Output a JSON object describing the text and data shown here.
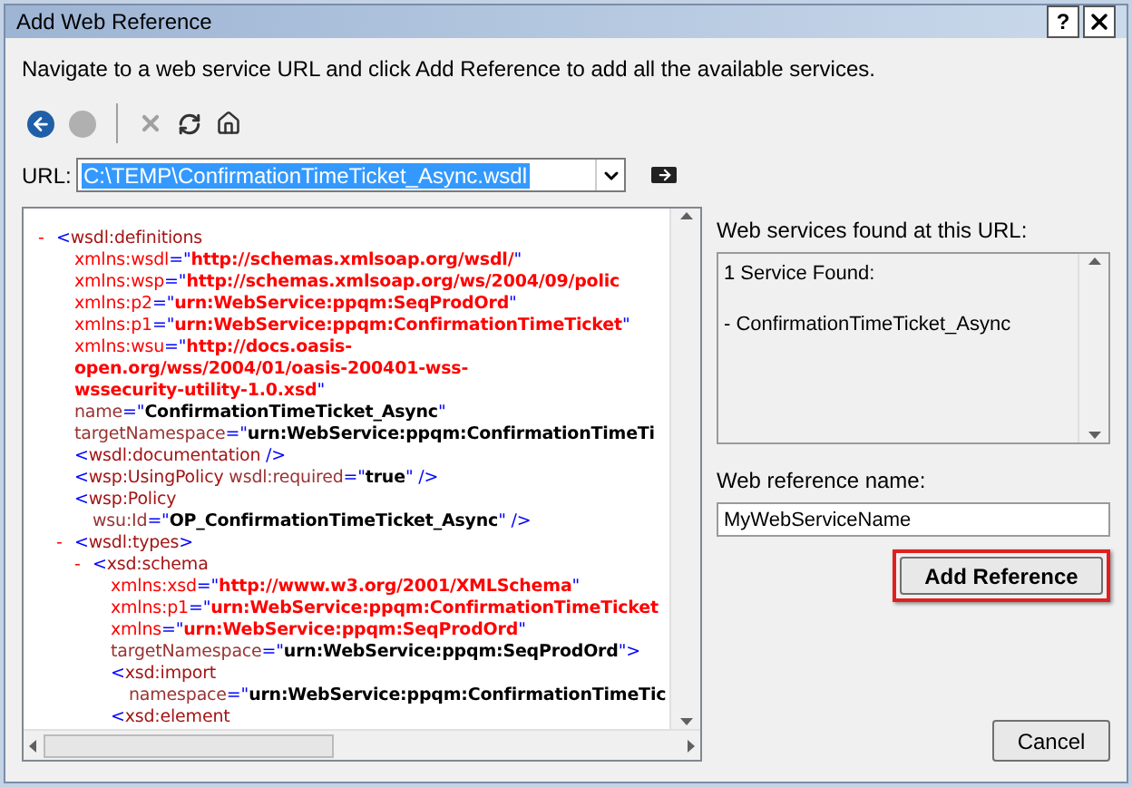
{
  "window": {
    "title": "Add Web Reference",
    "help": "?"
  },
  "instruction": "Navigate to a web service URL and click Add Reference to add all the available services.",
  "toolbar": [
    {
      "kind": "back",
      "disabled": false
    },
    {
      "kind": "stop",
      "disabled": true
    },
    {
      "kind": "separator"
    },
    {
      "kind": "delete",
      "disabled": true
    },
    {
      "kind": "refresh",
      "disabled": false
    },
    {
      "kind": "home",
      "disabled": false
    }
  ],
  "url": {
    "label": "URL:",
    "value": "C:\\TEMP\\ConfirmationTimeTicket_Async.wsdl",
    "text_selected": true
  },
  "xml": [
    {
      "toggle": "-",
      "lines": [
        [
          {
            "kind": "punct",
            "text": "<"
          },
          {
            "kind": "element",
            "text": "wsdl:definitions"
          }
        ],
        [
          {
            "kind": "ns_attr",
            "text": "xmlns:wsdl"
          },
          {
            "kind": "punct",
            "text": "=\""
          },
          {
            "kind": "ns_value",
            "text": "http://schemas.xmlsoap.org/wsdl/"
          },
          {
            "kind": "punct",
            "text": "\""
          }
        ],
        [
          {
            "kind": "ns_attr",
            "text": "xmlns:wsp"
          },
          {
            "kind": "punct",
            "text": "=\""
          },
          {
            "kind": "ns_value",
            "text": "http://schemas.xmlsoap.org/ws/2004/09/polic"
          }
        ],
        [
          {
            "kind": "ns_attr",
            "text": "xmlns:p2"
          },
          {
            "kind": "punct",
            "text": "=\""
          },
          {
            "kind": "ns_value",
            "text": "urn:WebService:ppqm:SeqProdOrd"
          },
          {
            "kind": "punct",
            "text": "\""
          }
        ],
        [
          {
            "kind": "ns_attr",
            "text": "xmlns:p1"
          },
          {
            "kind": "punct",
            "text": "=\""
          },
          {
            "kind": "ns_value",
            "text": "urn:WebService:ppqm:ConfirmationTimeTicket"
          },
          {
            "kind": "punct",
            "text": "\""
          }
        ],
        [
          {
            "kind": "ns_attr",
            "text": "xmlns:wsu"
          },
          {
            "kind": "punct",
            "text": "=\""
          },
          {
            "kind": "ns_value",
            "text": "http://docs.oasis-"
          }
        ],
        [
          {
            "kind": "ns_value",
            "text": "open.org/wss/2004/01/oasis-200401-wss-"
          }
        ],
        [
          {
            "kind": "ns_value",
            "text": "wssecurity-utility-1.0.xsd"
          },
          {
            "kind": "punct",
            "text": "\""
          }
        ],
        [
          {
            "kind": "attr",
            "text": "name"
          },
          {
            "kind": "punct",
            "text": "=\""
          },
          {
            "kind": "value",
            "text": "ConfirmationTimeTicket_Async"
          },
          {
            "kind": "punct",
            "text": "\""
          }
        ],
        [
          {
            "kind": "attr",
            "text": "targetNamespace"
          },
          {
            "kind": "punct",
            "text": "=\""
          },
          {
            "kind": "value",
            "text": "urn:WebService:ppqm:ConfirmationTimeTi"
          }
        ]
      ],
      "children": [
        {
          "lines": [
            [
              {
                "kind": "punct",
                "text": "<"
              },
              {
                "kind": "element",
                "text": "wsdl:documentation"
              },
              {
                "kind": "punct",
                "text": " />"
              }
            ]
          ]
        },
        {
          "lines": [
            [
              {
                "kind": "punct",
                "text": "<"
              },
              {
                "kind": "element",
                "text": "wsp:UsingPolicy"
              },
              {
                "kind": "attr",
                "text": " wsdl:required"
              },
              {
                "kind": "punct",
                "text": "=\""
              },
              {
                "kind": "value",
                "text": "true"
              },
              {
                "kind": "punct",
                "text": "\" />"
              }
            ]
          ]
        },
        {
          "lines": [
            [
              {
                "kind": "punct",
                "text": "<"
              },
              {
                "kind": "element",
                "text": "wsp:Policy"
              }
            ],
            [
              {
                "kind": "attr",
                "text": "wsu:Id"
              },
              {
                "kind": "punct",
                "text": "=\""
              },
              {
                "kind": "value",
                "text": "OP_ConfirmationTimeTicket_Async"
              },
              {
                "kind": "punct",
                "text": "\" />"
              }
            ]
          ]
        },
        {
          "toggle": "-",
          "lines": [
            [
              {
                "kind": "punct",
                "text": "<"
              },
              {
                "kind": "element",
                "text": "wsdl:types"
              },
              {
                "kind": "punct",
                "text": ">"
              }
            ]
          ],
          "children": [
            {
              "toggle": "-",
              "lines": [
                [
                  {
                    "kind": "punct",
                    "text": "<"
                  },
                  {
                    "kind": "element",
                    "text": "xsd:schema"
                  }
                ],
                [
                  {
                    "kind": "ns_attr",
                    "text": "xmlns:xsd"
                  },
                  {
                    "kind": "punct",
                    "text": "=\""
                  },
                  {
                    "kind": "ns_value",
                    "text": "http://www.w3.org/2001/XMLSchema"
                  },
                  {
                    "kind": "punct",
                    "text": "\""
                  }
                ],
                [
                  {
                    "kind": "ns_attr",
                    "text": "xmlns:p1"
                  },
                  {
                    "kind": "punct",
                    "text": "=\""
                  },
                  {
                    "kind": "ns_value",
                    "text": "urn:WebService:ppqm:ConfirmationTimeTicket"
                  }
                ],
                [
                  {
                    "kind": "ns_attr",
                    "text": "xmlns"
                  },
                  {
                    "kind": "punct",
                    "text": "=\""
                  },
                  {
                    "kind": "ns_value",
                    "text": "urn:WebService:ppqm:SeqProdOrd"
                  },
                  {
                    "kind": "punct",
                    "text": "\""
                  }
                ],
                [
                  {
                    "kind": "attr",
                    "text": "targetNamespace"
                  },
                  {
                    "kind": "punct",
                    "text": "=\""
                  },
                  {
                    "kind": "value",
                    "text": "urn:WebService:ppqm:SeqProdOrd"
                  },
                  {
                    "kind": "punct",
                    "text": "\">"
                  }
                ]
              ],
              "children": [
                {
                  "lines": [
                    [
                      {
                        "kind": "punct",
                        "text": "<"
                      },
                      {
                        "kind": "element",
                        "text": "xsd:import"
                      }
                    ],
                    [
                      {
                        "kind": "attr",
                        "text": "namespace"
                      },
                      {
                        "kind": "punct",
                        "text": "=\""
                      },
                      {
                        "kind": "value",
                        "text": "urn:WebService:ppqm:ConfirmationTimeTic"
                      }
                    ]
                  ]
                },
                {
                  "lines": [
                    [
                      {
                        "kind": "punct",
                        "text": "<"
                      },
                      {
                        "kind": "element",
                        "text": "xsd:element"
                      }
                    ]
                  ]
                }
              ]
            }
          ]
        }
      ]
    }
  ],
  "services": {
    "label": "Web services found at this URL:",
    "lines": [
      "1 Service Found:",
      "- ConfirmationTimeTicket_Async"
    ]
  },
  "reference_name": {
    "label": "Web reference name:",
    "value": "MyWebServiceName"
  },
  "buttons": [
    {
      "kind": "add",
      "label": "Add Reference",
      "highlighted": true
    },
    {
      "kind": "cancel",
      "label": "Cancel",
      "highlighted": false
    }
  ]
}
